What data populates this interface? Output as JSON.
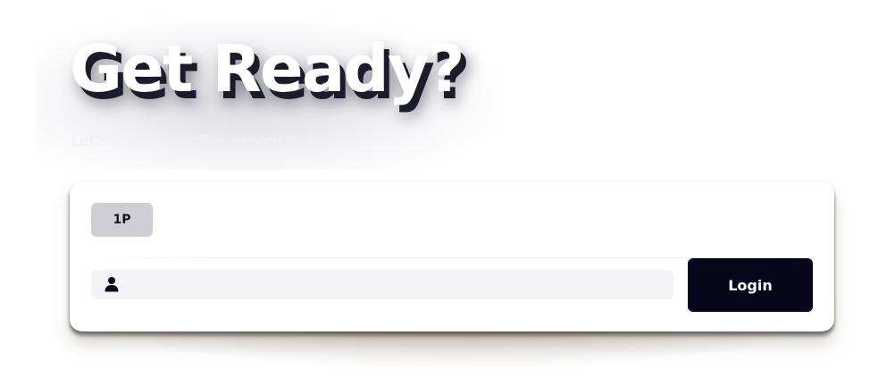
{
  "hero": {
    "title": "Get Ready?",
    "subtitle": "Let's Start the reflex exercise"
  },
  "card": {
    "player_tab_label": "1P",
    "name_input": {
      "value": "",
      "placeholder": ""
    },
    "login_label": "Login"
  },
  "icons": {
    "user": "user-icon"
  },
  "colors": {
    "title_text": "#ffffff",
    "title_shadow": "#1c1b2b",
    "tab_bg": "#cfced4",
    "input_bg": "#f4f4f6",
    "button_bg": "#07061a",
    "button_text": "#ffffff"
  }
}
